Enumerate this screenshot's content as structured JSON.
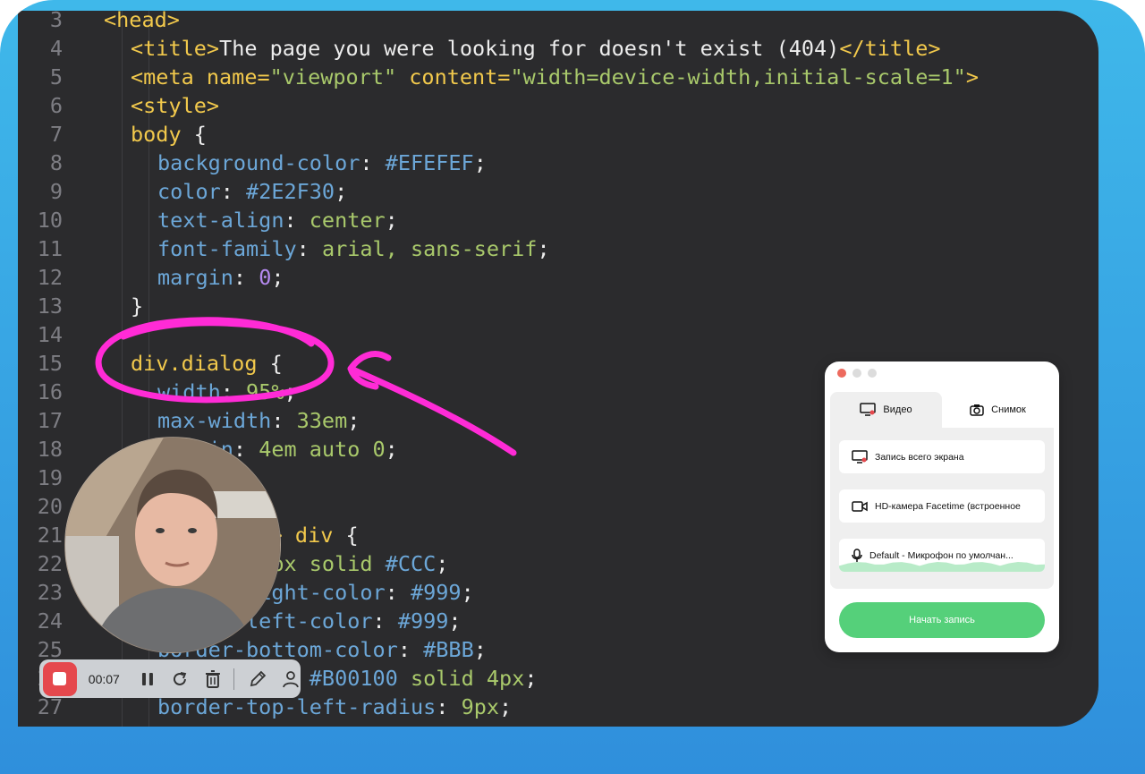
{
  "code_lines": [
    {
      "num": "3",
      "tokens": [
        {
          "t": "<head>",
          "c": "tag"
        }
      ]
    },
    {
      "num": "4",
      "tokens": [
        {
          "t": "<title>",
          "c": "tag"
        },
        {
          "t": "The page you were looking for doesn't exist (404)",
          "c": "text"
        },
        {
          "t": "</title>",
          "c": "tag"
        }
      ]
    },
    {
      "num": "5",
      "tokens": [
        {
          "t": "<meta ",
          "c": "tag"
        },
        {
          "t": "name=",
          "c": "attr"
        },
        {
          "t": "\"viewport\"",
          "c": "str"
        },
        {
          "t": " content=",
          "c": "attr"
        },
        {
          "t": "\"width=device-width,initial-scale=1\"",
          "c": "str"
        },
        {
          "t": ">",
          "c": "tag"
        }
      ]
    },
    {
      "num": "6",
      "tokens": [
        {
          "t": "<style>",
          "c": "tag"
        }
      ]
    },
    {
      "num": "7",
      "tokens": [
        {
          "t": "body ",
          "c": "sel"
        },
        {
          "t": "{",
          "c": "punc"
        }
      ]
    },
    {
      "num": "8",
      "tokens": [
        {
          "t": "background-color",
          "c": "prop"
        },
        {
          "t": ": ",
          "c": "punc"
        },
        {
          "t": "#EFEFEF",
          "c": "prop"
        },
        {
          "t": ";",
          "c": "punc"
        }
      ]
    },
    {
      "num": "9",
      "tokens": [
        {
          "t": "color",
          "c": "prop"
        },
        {
          "t": ": ",
          "c": "punc"
        },
        {
          "t": "#2E2F30",
          "c": "prop"
        },
        {
          "t": ";",
          "c": "punc"
        }
      ]
    },
    {
      "num": "10",
      "tokens": [
        {
          "t": "text-align",
          "c": "prop"
        },
        {
          "t": ": ",
          "c": "punc"
        },
        {
          "t": "center",
          "c": "val"
        },
        {
          "t": ";",
          "c": "punc"
        }
      ]
    },
    {
      "num": "11",
      "tokens": [
        {
          "t": "font-family",
          "c": "prop"
        },
        {
          "t": ": ",
          "c": "punc"
        },
        {
          "t": "arial, sans-serif",
          "c": "val"
        },
        {
          "t": ";",
          "c": "punc"
        }
      ]
    },
    {
      "num": "12",
      "tokens": [
        {
          "t": "margin",
          "c": "prop"
        },
        {
          "t": ": ",
          "c": "punc"
        },
        {
          "t": "0",
          "c": "num"
        },
        {
          "t": ";",
          "c": "punc"
        }
      ]
    },
    {
      "num": "13",
      "tokens": [
        {
          "t": "}",
          "c": "punc"
        }
      ]
    },
    {
      "num": "14",
      "tokens": []
    },
    {
      "num": "15",
      "tokens": [
        {
          "t": "div.dialog ",
          "c": "sel"
        },
        {
          "t": "{",
          "c": "punc"
        }
      ]
    },
    {
      "num": "16",
      "tokens": [
        {
          "t": "width",
          "c": "prop"
        },
        {
          "t": ": ",
          "c": "punc"
        },
        {
          "t": "95%",
          "c": "val"
        },
        {
          "t": ";",
          "c": "punc"
        }
      ]
    },
    {
      "num": "17",
      "tokens": [
        {
          "t": "max-width",
          "c": "prop"
        },
        {
          "t": ": ",
          "c": "punc"
        },
        {
          "t": "33em",
          "c": "val"
        },
        {
          "t": ";",
          "c": "punc"
        }
      ]
    },
    {
      "num": "18",
      "tokens": [
        {
          "t": "margin",
          "c": "prop"
        },
        {
          "t": ": ",
          "c": "punc"
        },
        {
          "t": "4em auto 0",
          "c": "val"
        },
        {
          "t": ";",
          "c": "punc"
        }
      ]
    },
    {
      "num": "19",
      "tokens": [
        {
          "t": "}",
          "c": "punc"
        }
      ]
    },
    {
      "num": "20",
      "tokens": []
    },
    {
      "num": "21",
      "tokens": [
        {
          "t": "div.dialog > div ",
          "c": "sel"
        },
        {
          "t": "{",
          "c": "punc"
        }
      ]
    },
    {
      "num": "22",
      "tokens": [
        {
          "t": "border",
          "c": "prop"
        },
        {
          "t": ": ",
          "c": "punc"
        },
        {
          "t": "1px solid ",
          "c": "val"
        },
        {
          "t": "#CCC",
          "c": "prop"
        },
        {
          "t": ";",
          "c": "punc"
        }
      ]
    },
    {
      "num": "23",
      "tokens": [
        {
          "t": "border-right-color",
          "c": "prop"
        },
        {
          "t": ": ",
          "c": "punc"
        },
        {
          "t": "#999",
          "c": "prop"
        },
        {
          "t": ";",
          "c": "punc"
        }
      ]
    },
    {
      "num": "24",
      "tokens": [
        {
          "t": "border-left-color",
          "c": "prop"
        },
        {
          "t": ": ",
          "c": "punc"
        },
        {
          "t": "#999",
          "c": "prop"
        },
        {
          "t": ";",
          "c": "punc"
        }
      ]
    },
    {
      "num": "25",
      "tokens": [
        {
          "t": "border-bottom-color",
          "c": "prop"
        },
        {
          "t": ": ",
          "c": "punc"
        },
        {
          "t": "#BBB",
          "c": "prop"
        },
        {
          "t": ";",
          "c": "punc"
        }
      ]
    },
    {
      "num": "26",
      "tokens": [
        {
          "t": "border-top",
          "c": "prop"
        },
        {
          "t": ": ",
          "c": "punc"
        },
        {
          "t": "#B00100",
          "c": "prop"
        },
        {
          "t": " solid 4px",
          "c": "val"
        },
        {
          "t": ";",
          "c": "punc"
        }
      ]
    },
    {
      "num": "27",
      "tokens": [
        {
          "t": "border-top-left-radius",
          "c": "prop"
        },
        {
          "t": ": ",
          "c": "punc"
        },
        {
          "t": "9px",
          "c": "val"
        },
        {
          "t": ";",
          "c": "punc"
        }
      ]
    },
    {
      "num": "28",
      "tokens": [
        {
          "t": "border-top-right-radius",
          "c": "prop"
        },
        {
          "t": ": ",
          "c": "punc"
        },
        {
          "t": "9px",
          "c": "val"
        },
        {
          "t": ";",
          "c": "punc"
        }
      ]
    }
  ],
  "recorder_toolbar": {
    "timer": "00:07",
    "icons": [
      "pause-icon",
      "restart-icon",
      "trash-icon",
      "pen-icon",
      "user-icon"
    ]
  },
  "recorder_panel": {
    "tabs": [
      {
        "label": "Видео",
        "icon": "monitor-icon",
        "active": true
      },
      {
        "label": "Снимок",
        "icon": "camera-icon",
        "active": false
      }
    ],
    "options": [
      {
        "label": "Запись всего экрана",
        "icon": "monitor-icon"
      },
      {
        "label": "HD-камера Facetime (встроенное",
        "icon": "video-camera-icon"
      },
      {
        "label": "Default - Микрофон по умолчан...",
        "icon": "microphone-icon",
        "audio_level": 0.55
      }
    ],
    "start_button": "Начать запись",
    "window_lights": [
      "#ed6a5e",
      "#dcdcdc",
      "#dcdcdc"
    ]
  },
  "colors": {
    "frame_top": "#3fb8ea",
    "frame_bottom": "#2f8fdc",
    "editor_bg": "#2b2b2d",
    "annotation": "#ff2bd6",
    "stop_button": "#e5484d",
    "start_button": "#55d07a"
  }
}
